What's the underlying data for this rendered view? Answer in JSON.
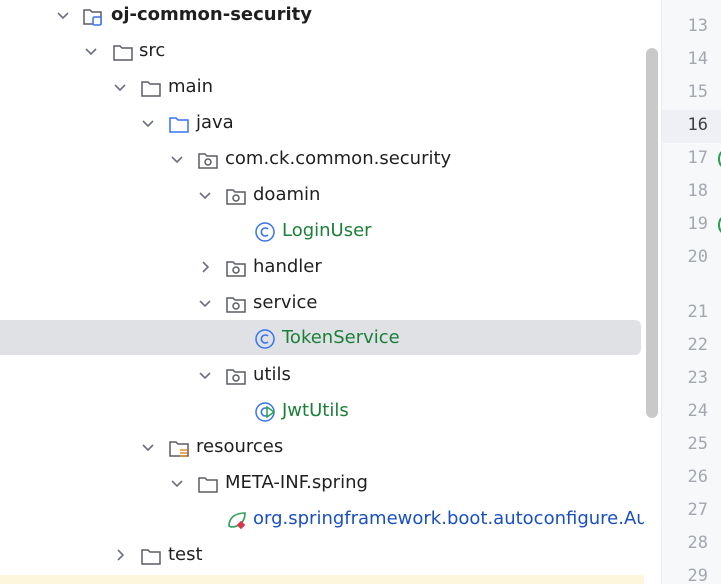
{
  "tree": {
    "items": [
      {
        "label": "oj-common-security",
        "kind": "module",
        "expanded": true
      },
      {
        "label": "src",
        "kind": "folder",
        "expanded": true
      },
      {
        "label": "main",
        "kind": "folder",
        "expanded": true
      },
      {
        "label": "java",
        "kind": "source-folder",
        "expanded": true
      },
      {
        "label": "com.ck.common.security",
        "kind": "package",
        "expanded": true
      },
      {
        "label": "doamin",
        "kind": "package",
        "expanded": true
      },
      {
        "label": "LoginUser",
        "kind": "class"
      },
      {
        "label": "handler",
        "kind": "package",
        "expanded": false
      },
      {
        "label": "service",
        "kind": "package",
        "expanded": true
      },
      {
        "label": "TokenService",
        "kind": "class",
        "selected": true
      },
      {
        "label": "utils",
        "kind": "package",
        "expanded": true
      },
      {
        "label": "JwtUtils",
        "kind": "class-runnable"
      },
      {
        "label": "resources",
        "kind": "resources-folder",
        "expanded": true
      },
      {
        "label": "META-INF.spring",
        "kind": "folder",
        "expanded": true
      },
      {
        "label": "org.springframework.boot.autoconfigure.AutoC",
        "kind": "spring-file"
      },
      {
        "label": "test",
        "kind": "folder",
        "expanded": false
      }
    ]
  },
  "gutter": {
    "active_line": "16",
    "lines": [
      "13",
      "14",
      "15",
      "16",
      "17",
      "18",
      "19",
      "20",
      "21",
      "22",
      "23",
      "24",
      "25",
      "26",
      "27",
      "28",
      "29"
    ]
  },
  "colors": {
    "selection": "#dfe1e5",
    "class_name_green": "#1a7f37",
    "link_blue": "#1a4fbf",
    "folder_stroke": "#5a5d63",
    "source_folder_blue": "#3574f0",
    "class_icon_blue": "#3574f0"
  },
  "icons": {
    "chevron_down": "chevron-down-icon",
    "chevron_right": "chevron-right-icon",
    "folder": "folder-icon",
    "package": "package-icon",
    "class": "class-icon",
    "module": "module-icon",
    "spring": "spring-leaf-icon"
  }
}
